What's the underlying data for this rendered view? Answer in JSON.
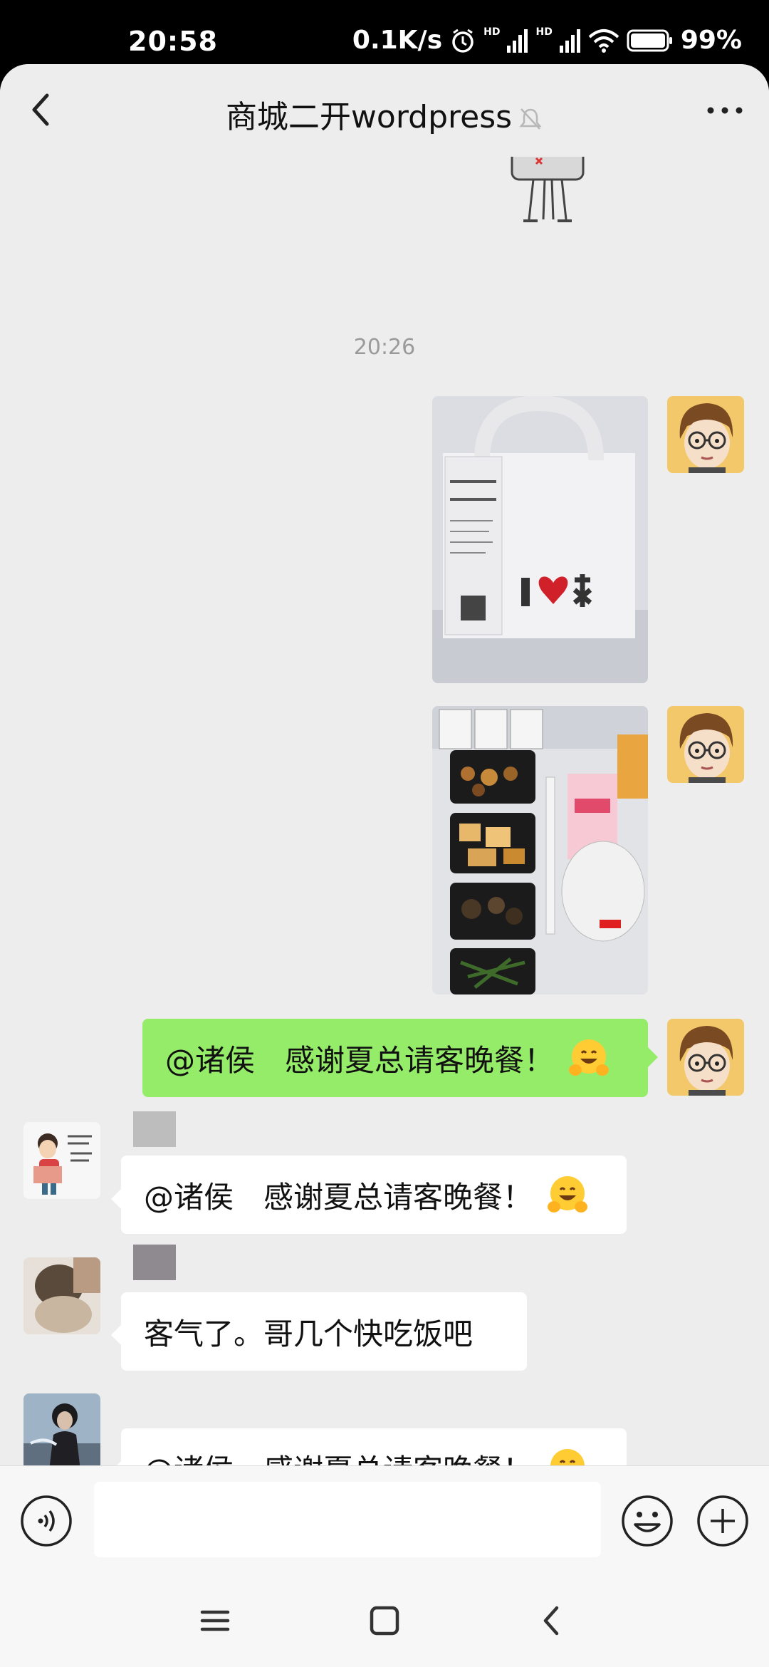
{
  "status_bar": {
    "time": "20:58",
    "network_speed": "0.1K/s",
    "signal_label_1": "HD",
    "signal_label_2": "HD",
    "battery": "99%"
  },
  "header": {
    "title": "商城二开wordpress",
    "back_icon": "chevron-left-icon",
    "more_icon": "more-dots-icon"
  },
  "chat": {
    "timestamp": "20:26",
    "messages": [
      {
        "side": "right",
        "type": "image",
        "content": "food-bag-photo"
      },
      {
        "side": "right",
        "type": "image",
        "content": "meal-boxes-photo"
      },
      {
        "side": "right",
        "type": "text",
        "text": "@诸侯　感谢夏总请客晚餐！",
        "emoji": "hugging-face-emoji"
      },
      {
        "side": "left",
        "type": "text",
        "text": "@诸侯　感谢夏总请客晚餐！",
        "emoji": "hugging-face-emoji"
      },
      {
        "side": "left",
        "type": "text",
        "text": "客气了。哥几个快吃饭吧"
      },
      {
        "side": "left",
        "type": "text",
        "text": "@诸侯　感谢夏总请客晚餐！",
        "emoji": "hugging-face-emoji"
      }
    ]
  },
  "input_bar": {
    "placeholder": "",
    "voice_icon": "voice-icon",
    "emoji_icon": "emoji-icon",
    "plus_icon": "plus-icon"
  },
  "nav_bar": {
    "menu_icon": "menu-icon",
    "home_icon": "home-icon",
    "back_icon": "back-icon"
  },
  "colors": {
    "background": "#ededed",
    "sent_bubble": "#95ec69",
    "received_bubble": "#ffffff",
    "timestamp": "#9a9a9a"
  }
}
